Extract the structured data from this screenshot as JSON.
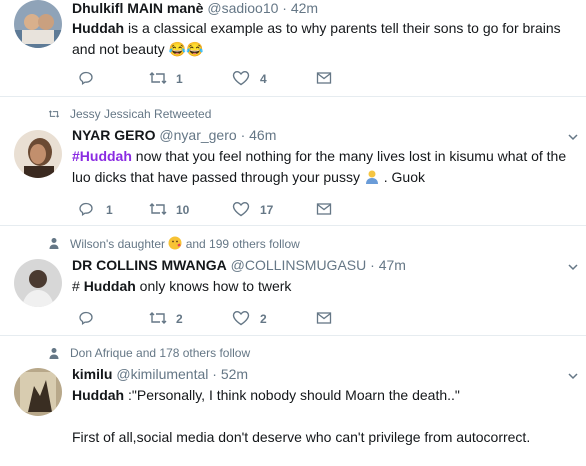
{
  "tweets": [
    {
      "name": "Dhulkifl MAIN manè",
      "handle": "@sadioo10",
      "time": "42m",
      "text_bold": "Huddah",
      "text_line1": " is a classical example as to why parents tell their sons to go for brains",
      "text_line2": "and not beauty",
      "emoji": "😂😂",
      "replies": "",
      "retweets": "1",
      "likes": "4"
    },
    {
      "context": "Jessy Jessicah Retweeted",
      "name": "NYAR GERO",
      "handle": "@nyar_gero",
      "time": "46m",
      "hashtag": "#Huddah",
      "text_line1": " now that you feel nothing for the many lives lost in kisumu what of the",
      "text_line2": "luo dicks that have passed through your pussy",
      "text_line2_end": ". Guok",
      "replies": "1",
      "retweets": "10",
      "likes": "17"
    },
    {
      "context_name": "Wilson's daughter",
      "context_rest": "and 199 others follow",
      "name": "DR COLLINS MWANGA",
      "handle": "@COLLINSMUGASU",
      "time": "47m",
      "text_prefix": "# ",
      "text_bold": "Huddah",
      "text_rest": " only knows how to twerk",
      "replies": "",
      "retweets": "2",
      "likes": "2"
    },
    {
      "context": "Don Afrique and 178 others follow",
      "name": "kimilu",
      "handle": "@kimilumental",
      "time": "52m",
      "text_bold": "Huddah",
      "text_rest": " :\"Personally, I think nobody should Moarn the death..\"",
      "text_line3": "First of all,social media don't deserve who can't privilege from autocorrect."
    }
  ],
  "dot": "·"
}
